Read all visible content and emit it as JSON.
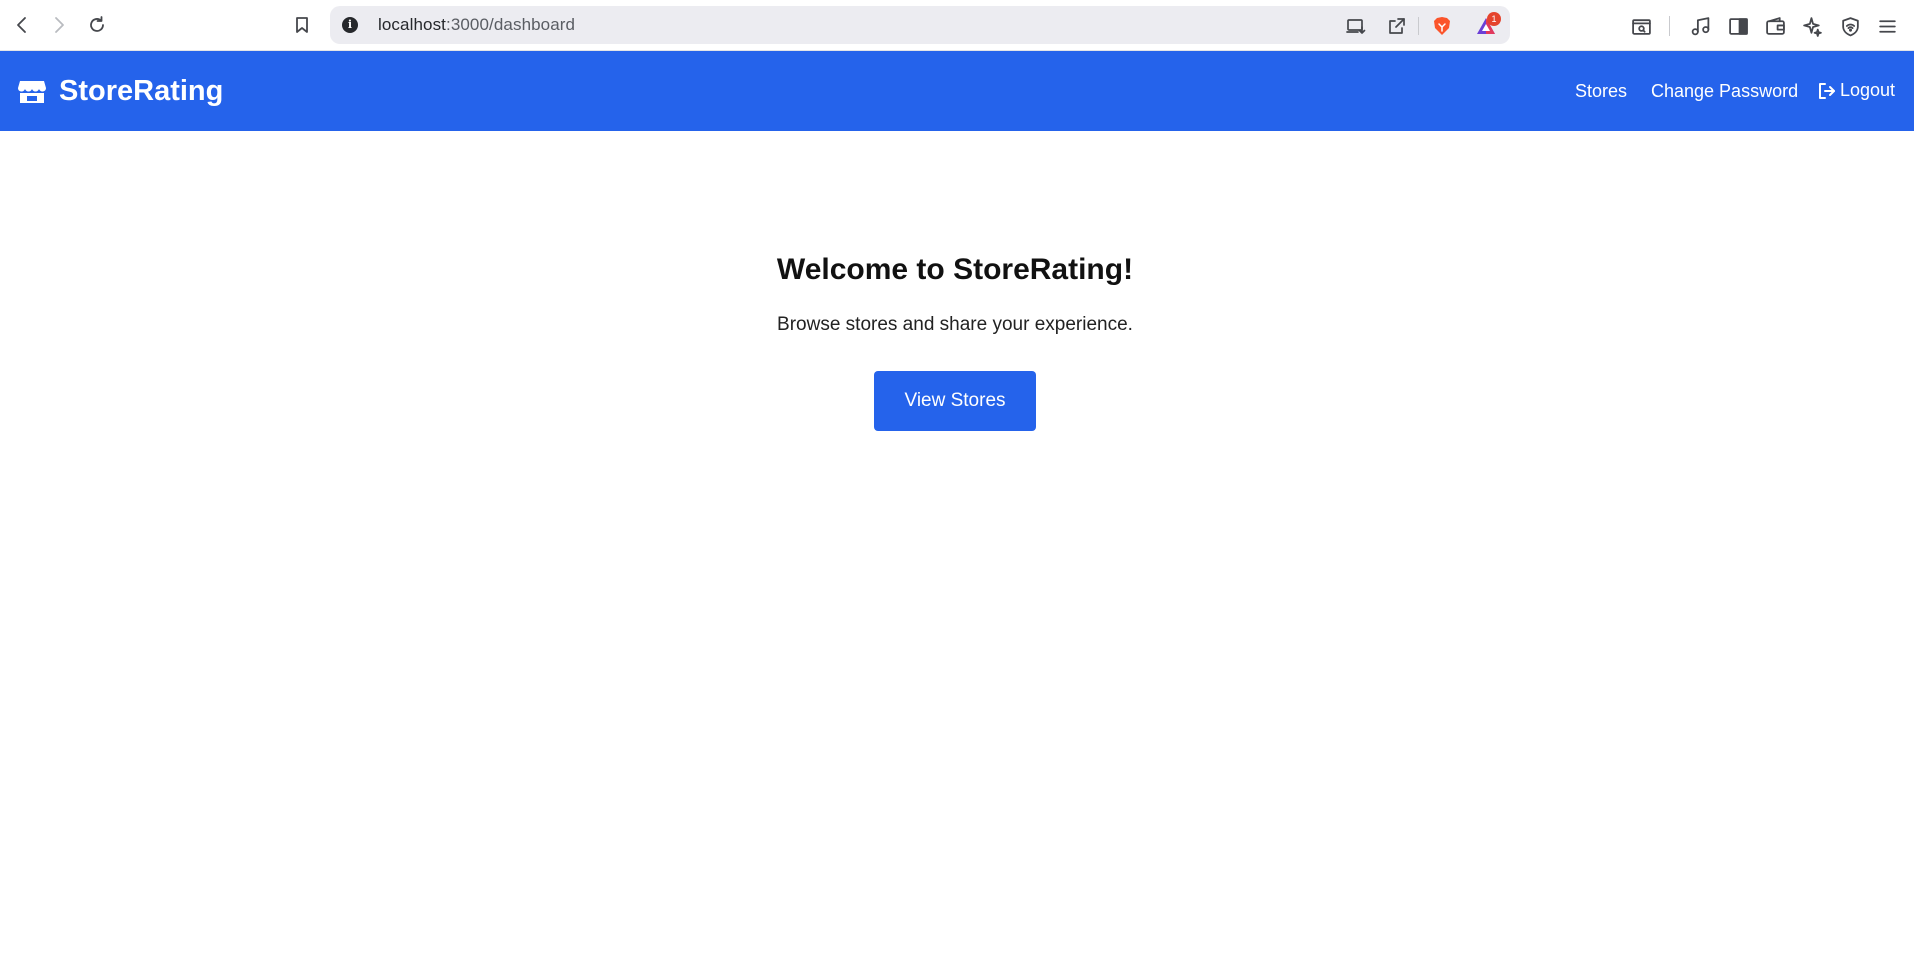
{
  "browser": {
    "url_host": "localhost",
    "url_path": ":3000/dashboard",
    "notification_count": "1",
    "icons": [
      "back-icon",
      "forward-icon",
      "reload-icon",
      "bookmark-icon",
      "site-info-icon",
      "install-app-icon",
      "share-icon",
      "brave-shields-icon",
      "brave-rewards-icon",
      "tab-search-icon",
      "media-icon",
      "sidebar-icon",
      "wallet-icon",
      "leo-ai-icon",
      "vpn-icon",
      "menu-icon"
    ]
  },
  "navbar": {
    "brand": "StoreRating",
    "links": {
      "stores": "Stores",
      "change_password": "Change Password",
      "logout": "Logout"
    },
    "color": "#2563eb"
  },
  "main": {
    "title": "Welcome to StoreRating!",
    "subtitle": "Browse stores and share your experience.",
    "button_label": "View Stores"
  }
}
